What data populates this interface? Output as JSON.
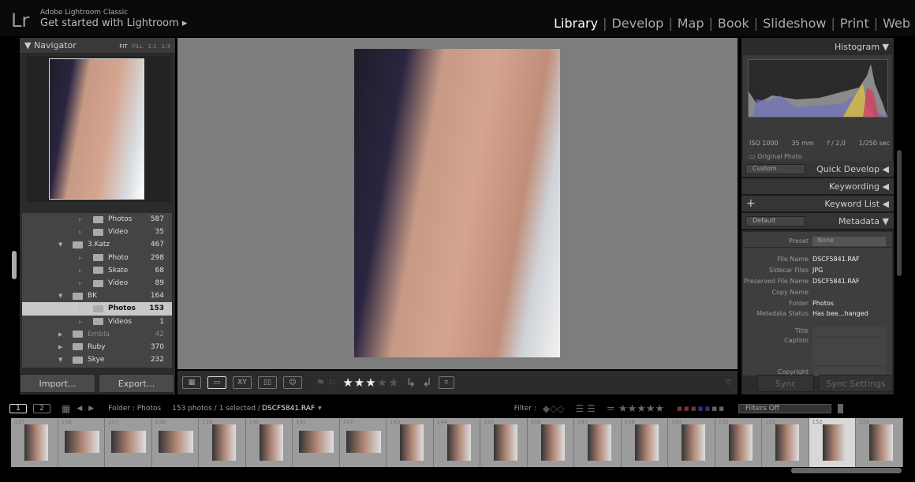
{
  "header": {
    "logo": "Lr",
    "app_name": "Adobe Lightroom Classic",
    "identity": "Get started with Lightroom ▸",
    "modules": [
      "Library",
      "Develop",
      "Map",
      "Book",
      "Slideshow",
      "Print",
      "Web"
    ],
    "active_module": "Library"
  },
  "navigator": {
    "title": "Navigator",
    "zoom_options": [
      "FIT",
      "FILL",
      "1:1",
      "1:3"
    ]
  },
  "folders": [
    {
      "name": "Photos",
      "count": "587",
      "level": 2
    },
    {
      "name": "Video",
      "count": "35",
      "level": 2
    },
    {
      "name": "3.Katz",
      "count": "467",
      "level": 1
    },
    {
      "name": "Photo",
      "count": "298",
      "level": 2
    },
    {
      "name": "Skate",
      "count": "68",
      "level": 2
    },
    {
      "name": "Video",
      "count": "89",
      "level": 2
    },
    {
      "name": "BK",
      "count": "164",
      "level": 1
    },
    {
      "name": "Photos",
      "count": "153",
      "level": 2,
      "selected": true
    },
    {
      "name": "Videos",
      "count": "1",
      "level": 2
    },
    {
      "name": "Embla",
      "count": "42",
      "level": 1,
      "offline": true
    },
    {
      "name": "Ruby",
      "count": "370",
      "level": 1
    },
    {
      "name": "Skye",
      "count": "232",
      "level": 1
    }
  ],
  "left_buttons": {
    "import": "Import...",
    "export": "Export..."
  },
  "toolbar": {
    "rating": 3,
    "max_rating": 5
  },
  "histogram": {
    "title": "Histogram",
    "iso": "ISO 1000",
    "focal": "35 mm",
    "aperture": "f / 2,0",
    "shutter": "1/250 sec",
    "original_photo": "Original Photo"
  },
  "right_panels": {
    "quick_develop": "Quick Develop",
    "qd_preset": "Custom",
    "keywording": "Keywording",
    "keyword_list": "Keyword List",
    "metadata": "Metadata",
    "md_preset": "Default"
  },
  "metadata": {
    "preset_label": "Preset",
    "preset_value": "None",
    "rows": [
      {
        "k": "File Name",
        "v": "DSCF5841.RAF"
      },
      {
        "k": "Sidecar Files",
        "v": "JPG"
      },
      {
        "k": "Preserved File Name",
        "v": "DSCF5841.RAF"
      },
      {
        "k": "Copy Name",
        "v": ""
      },
      {
        "k": "Folder",
        "v": "Photos"
      },
      {
        "k": "Metadata Status",
        "v": "Has bee…hanged"
      }
    ],
    "title_label": "Title",
    "caption_label": "Caption",
    "copyright_label": "Copyright"
  },
  "sync": {
    "sync": "Sync",
    "sync_settings": "Sync Settings"
  },
  "filmbar": {
    "view1": "1",
    "view2": "2",
    "source": "Folder : Photos",
    "count": "153 photos / 1 selected /",
    "file": "DSCF5841.RAF",
    "filter_label": "Filter :",
    "filters_off": "Filters Off"
  },
  "filmstrip": [
    "135",
    "136",
    "137",
    "138",
    "139",
    "140",
    "141",
    "142",
    "143",
    "144",
    "145",
    "146",
    "147",
    "148",
    "149",
    "150",
    "151",
    "152",
    "153"
  ],
  "filmstrip_selected": "152"
}
